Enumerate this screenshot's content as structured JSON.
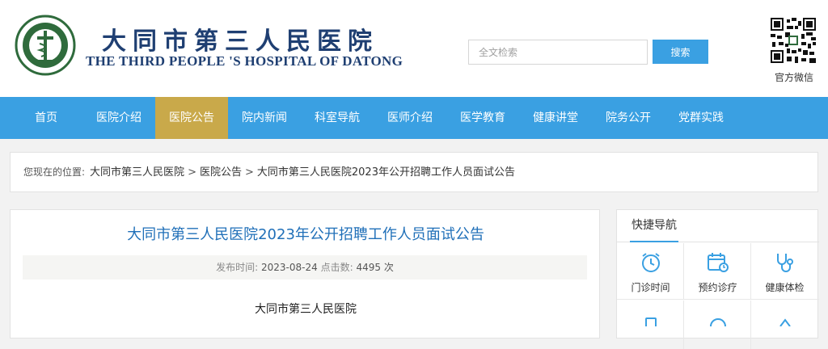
{
  "header": {
    "name_cn": "大同市第三人民医院",
    "name_en": "THE THIRD PEOPLE 'S HOSPITAL OF DATONG",
    "search_placeholder": "全文检索",
    "search_button": "搜索",
    "qr_label": "官方微信"
  },
  "nav": {
    "items": [
      "首页",
      "医院介绍",
      "医院公告",
      "院内新闻",
      "科室导航",
      "医师介绍",
      "医学教育",
      "健康讲堂",
      "院务公开",
      "党群实践"
    ],
    "active": "医院公告"
  },
  "breadcrumb": {
    "prefix": "您现在的位置:",
    "crumbs": [
      "大同市第三人民医院",
      "医院公告",
      "大同市第三人民医院2023年公开招聘工作人员面试公告"
    ],
    "separator": ">"
  },
  "article": {
    "title": "大同市第三人民医院2023年公开招聘工作人员面试公告",
    "publish_label": "发布时间:",
    "publish_date": "2023-08-24",
    "views_label": "点击数:",
    "views": "4495",
    "views_unit": "次",
    "body_first_line": "大同市第三人民医院"
  },
  "sidebar": {
    "title": "快捷导航",
    "items": [
      {
        "label": "门诊时间",
        "icon": "alarm-clock-icon"
      },
      {
        "label": "预约诊疗",
        "icon": "calendar-clock-icon"
      },
      {
        "label": "健康体检",
        "icon": "stethoscope-icon"
      }
    ]
  },
  "colors": {
    "nav_bg": "#3aa0e2",
    "nav_active": "#c9a94a",
    "brand_navy": "#1f3f72",
    "title_blue": "#1f6fb8"
  }
}
